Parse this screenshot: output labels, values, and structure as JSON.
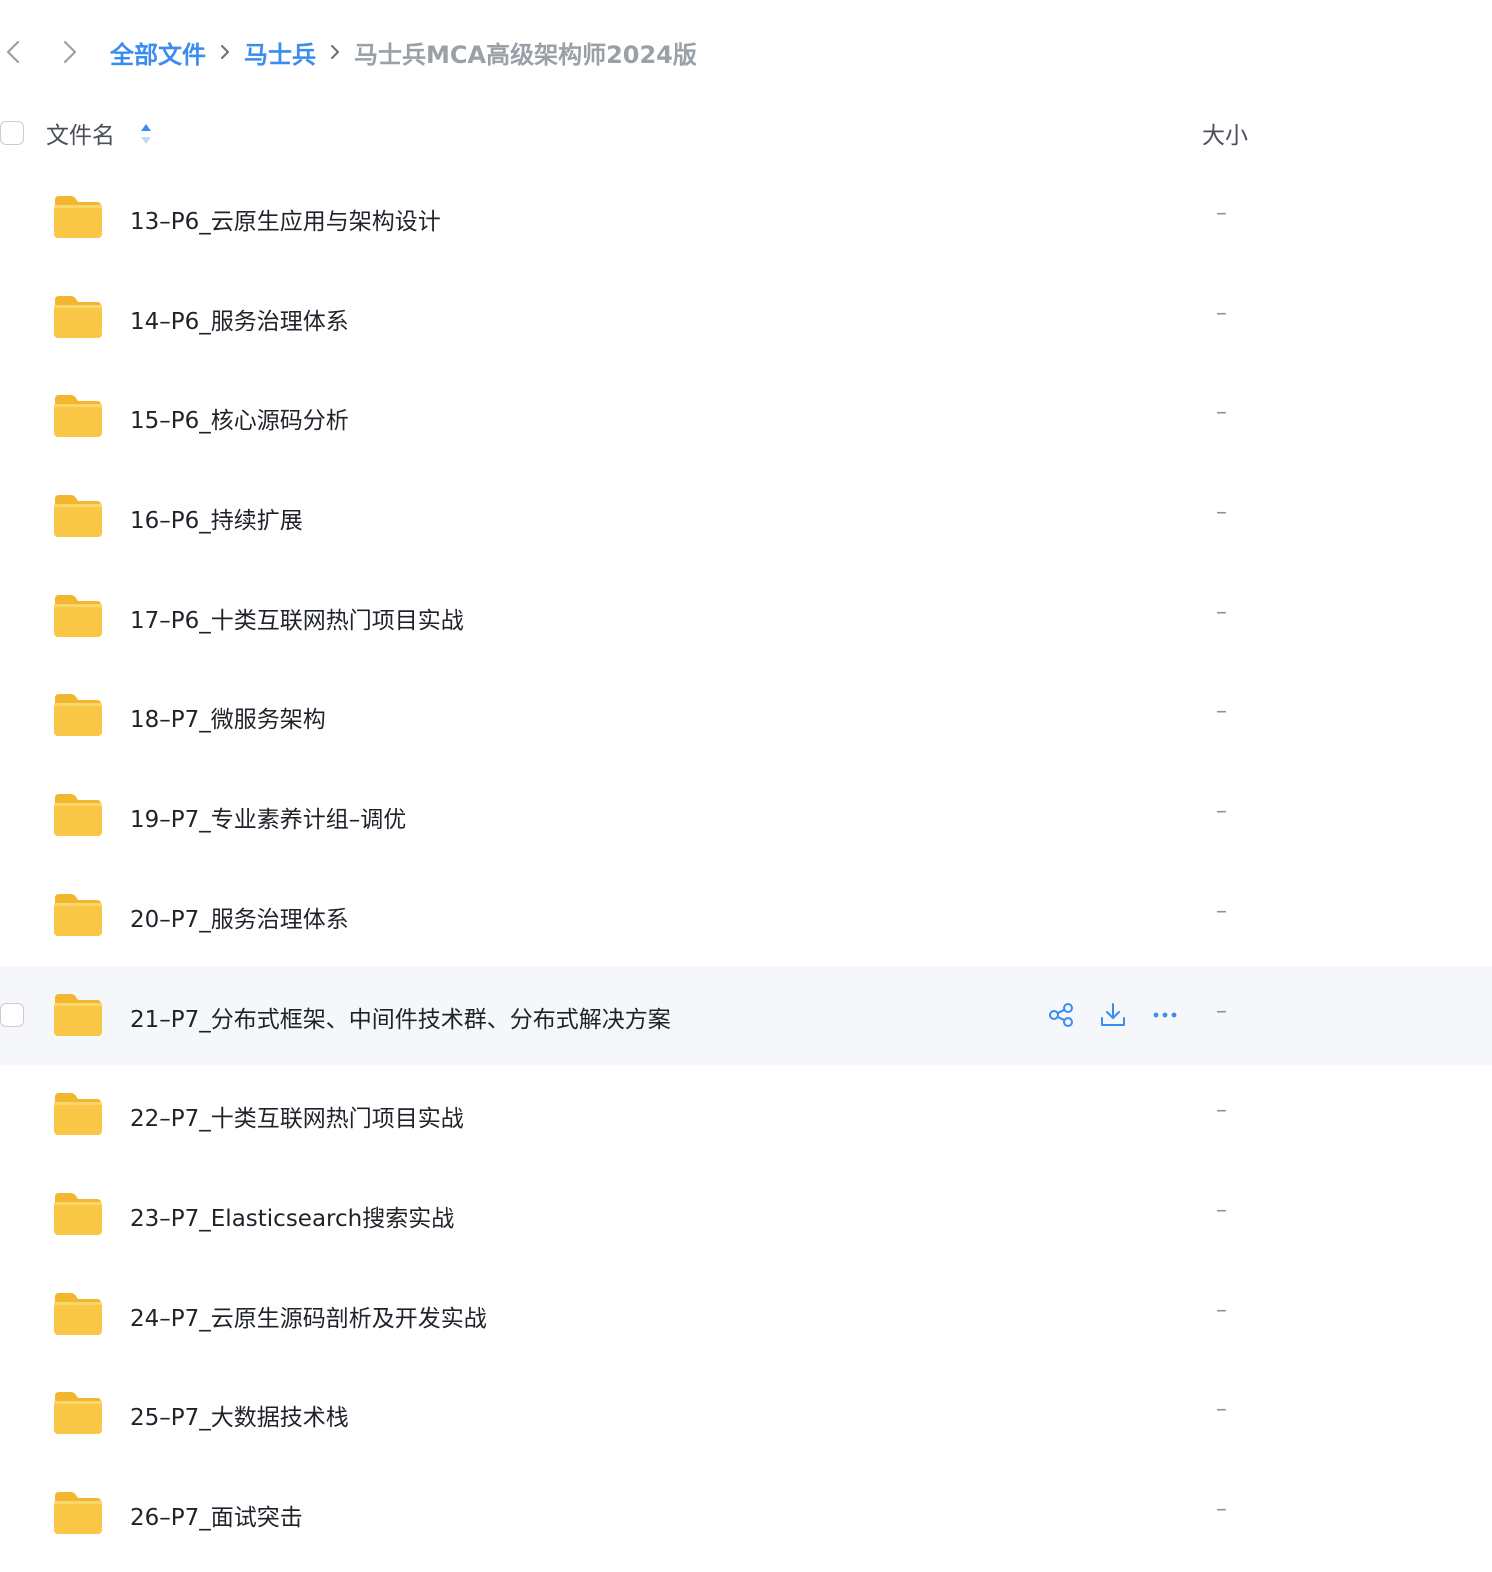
{
  "breadcrumb": {
    "items": [
      {
        "label": "全部文件"
      },
      {
        "label": "马士兵"
      }
    ],
    "current": "马士兵MCA高级架构师2024版"
  },
  "header": {
    "name_label": "文件名",
    "size_label": "大小"
  },
  "colors": {
    "accent": "#3a8cef",
    "folder": "#f9c646",
    "hover_row": "#f5f7fa"
  },
  "files": [
    {
      "name": "13–P6_云原生应用与架构设计",
      "size": "–",
      "icon": "folder-icon"
    },
    {
      "name": "14–P6_服务治理体系",
      "size": "–",
      "icon": "folder-icon"
    },
    {
      "name": "15–P6_核心源码分析",
      "size": "–",
      "icon": "folder-icon"
    },
    {
      "name": "16–P6_持续扩展",
      "size": "–",
      "icon": "folder-icon"
    },
    {
      "name": "17–P6_十类互联网热门项目实战",
      "size": "–",
      "icon": "folder-icon"
    },
    {
      "name": "18–P7_微服务架构",
      "size": "–",
      "icon": "folder-icon"
    },
    {
      "name": "19–P7_专业素养计组–调优",
      "size": "–",
      "icon": "folder-icon"
    },
    {
      "name": "20–P7_服务治理体系",
      "size": "–",
      "icon": "folder-icon"
    },
    {
      "name": "21–P7_分布式框架、中间件技术群、分布式解决方案",
      "size": "–",
      "icon": "folder-icon",
      "hovered": true,
      "actions": [
        "share-icon",
        "download-icon",
        "more-icon"
      ]
    },
    {
      "name": "22–P7_十类互联网热门项目实战",
      "size": "–",
      "icon": "folder-icon"
    },
    {
      "name": "23–P7_Elasticsearch搜索实战",
      "size": "–",
      "icon": "folder-icon"
    },
    {
      "name": "24–P7_云原生源码剖析及开发实战",
      "size": "–",
      "icon": "folder-icon"
    },
    {
      "name": "25–P7_大数据技术栈",
      "size": "–",
      "icon": "folder-icon"
    },
    {
      "name": "26–P7_面试突击",
      "size": "–",
      "icon": "folder-icon"
    }
  ]
}
